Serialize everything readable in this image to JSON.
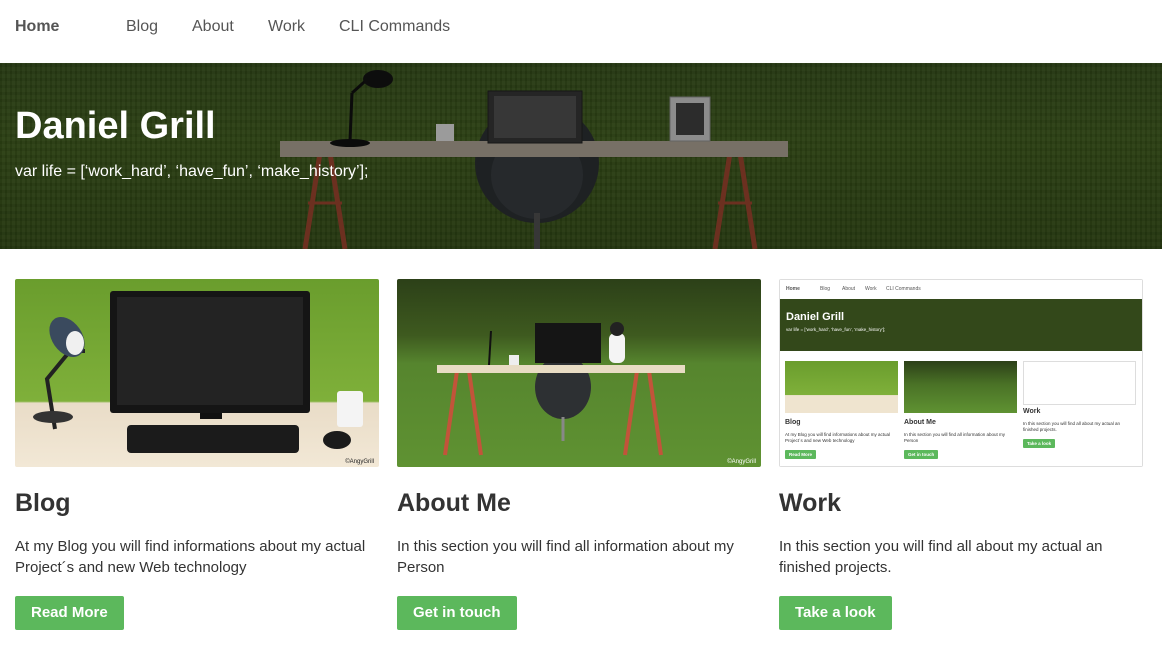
{
  "nav": {
    "brand": "Home",
    "links": [
      "Blog",
      "About",
      "Work",
      "CLI Commands"
    ]
  },
  "hero": {
    "title": "Daniel Grill",
    "subtitle": "var life = [‘work_hard’, ‘have_fun’, ‘make_history’];"
  },
  "cards": [
    {
      "title": "Blog",
      "text": "At my Blog you will find informations about my actual Project´s and new Web technology",
      "button": "Read More",
      "watermark": "©AngyGrill"
    },
    {
      "title": "About Me",
      "text": "In this section you will find all information about my Person",
      "button": "Get in touch",
      "watermark": "©AngyGrill"
    },
    {
      "title": "Work",
      "text": "In this section you will find all about my actual an finished projects.",
      "button": "Take a look"
    }
  ],
  "colors": {
    "accent": "#5cb85c",
    "nav_text": "#555555",
    "body_text": "#333333"
  }
}
